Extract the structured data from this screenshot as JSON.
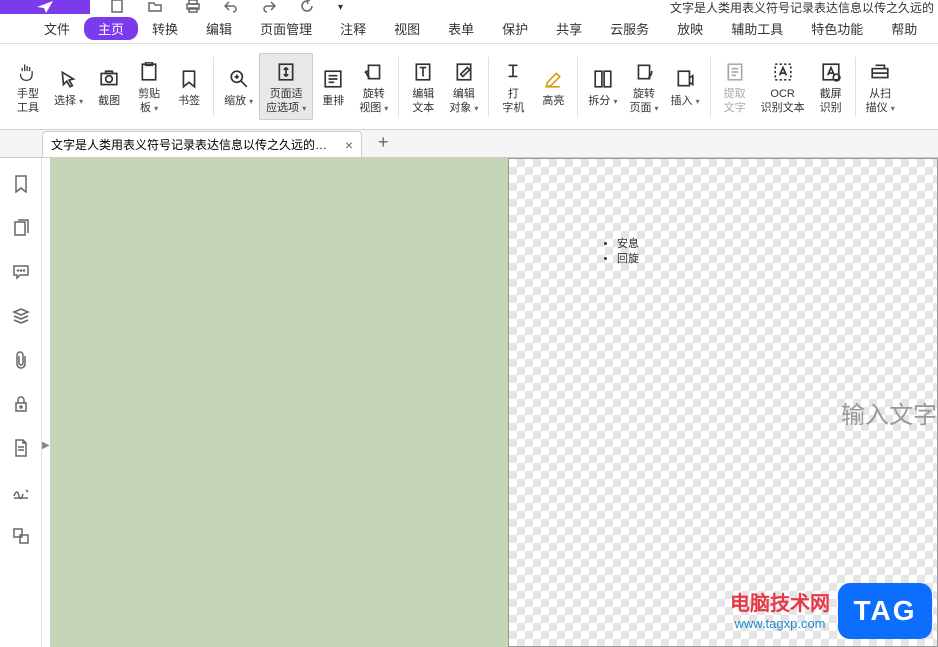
{
  "title_text": "文字是人类用表义符号记录表达信息以传之久远的",
  "menu": {
    "items": [
      "文件",
      "主页",
      "转换",
      "编辑",
      "页面管理",
      "注释",
      "视图",
      "表单",
      "保护",
      "共享",
      "云服务",
      "放映",
      "辅助工具",
      "特色功能",
      "帮助"
    ],
    "active_index": 1
  },
  "ribbon": [
    {
      "label": "手型\n工具",
      "icon": "hand"
    },
    {
      "label": "选择",
      "icon": "select",
      "arrow": true
    },
    {
      "label": "截图",
      "icon": "screenshot"
    },
    {
      "label": "剪贴\n板",
      "icon": "clipboard",
      "arrow": true
    },
    {
      "label": "书签",
      "icon": "bookmark"
    },
    {
      "label": "缩放",
      "icon": "zoom",
      "arrow": true,
      "sep_before": true
    },
    {
      "label": "页面适\n应选项",
      "icon": "fit",
      "arrow": true,
      "active": true
    },
    {
      "label": "重排",
      "icon": "reflow"
    },
    {
      "label": "旋转\n视图",
      "icon": "rotate-view",
      "arrow": true
    },
    {
      "label": "编辑\n文本",
      "icon": "edit-text",
      "sep_before": true
    },
    {
      "label": "编辑\n对象",
      "icon": "edit-obj",
      "arrow": true
    },
    {
      "label": "打\n字机",
      "icon": "typewriter",
      "sep_before": true
    },
    {
      "label": "高亮",
      "icon": "highlight"
    },
    {
      "label": "拆分",
      "icon": "split",
      "arrow": true,
      "sep_before": true
    },
    {
      "label": "旋转\n页面",
      "icon": "rotate-page",
      "arrow": true
    },
    {
      "label": "插入",
      "icon": "insert",
      "arrow": true
    },
    {
      "label": "提取\n文字",
      "icon": "extract",
      "disabled": true,
      "sep_before": true
    },
    {
      "label": "OCR\n识别文本",
      "icon": "ocr"
    },
    {
      "label": "截屏\n识别",
      "icon": "screen-ocr"
    },
    {
      "label": "从扫\n描仪",
      "icon": "scanner",
      "arrow": true,
      "sep_before": true
    }
  ],
  "tab": {
    "label": "文字是人类用表义符号记录表达信息以传之久远的方...",
    "close": "×"
  },
  "document": {
    "bullets": [
      "安息",
      "回旋"
    ],
    "placeholder": "输入文字"
  },
  "watermark": {
    "cn": "电脑技术网",
    "url": "www.tagxp.com",
    "badge": "TAG"
  }
}
